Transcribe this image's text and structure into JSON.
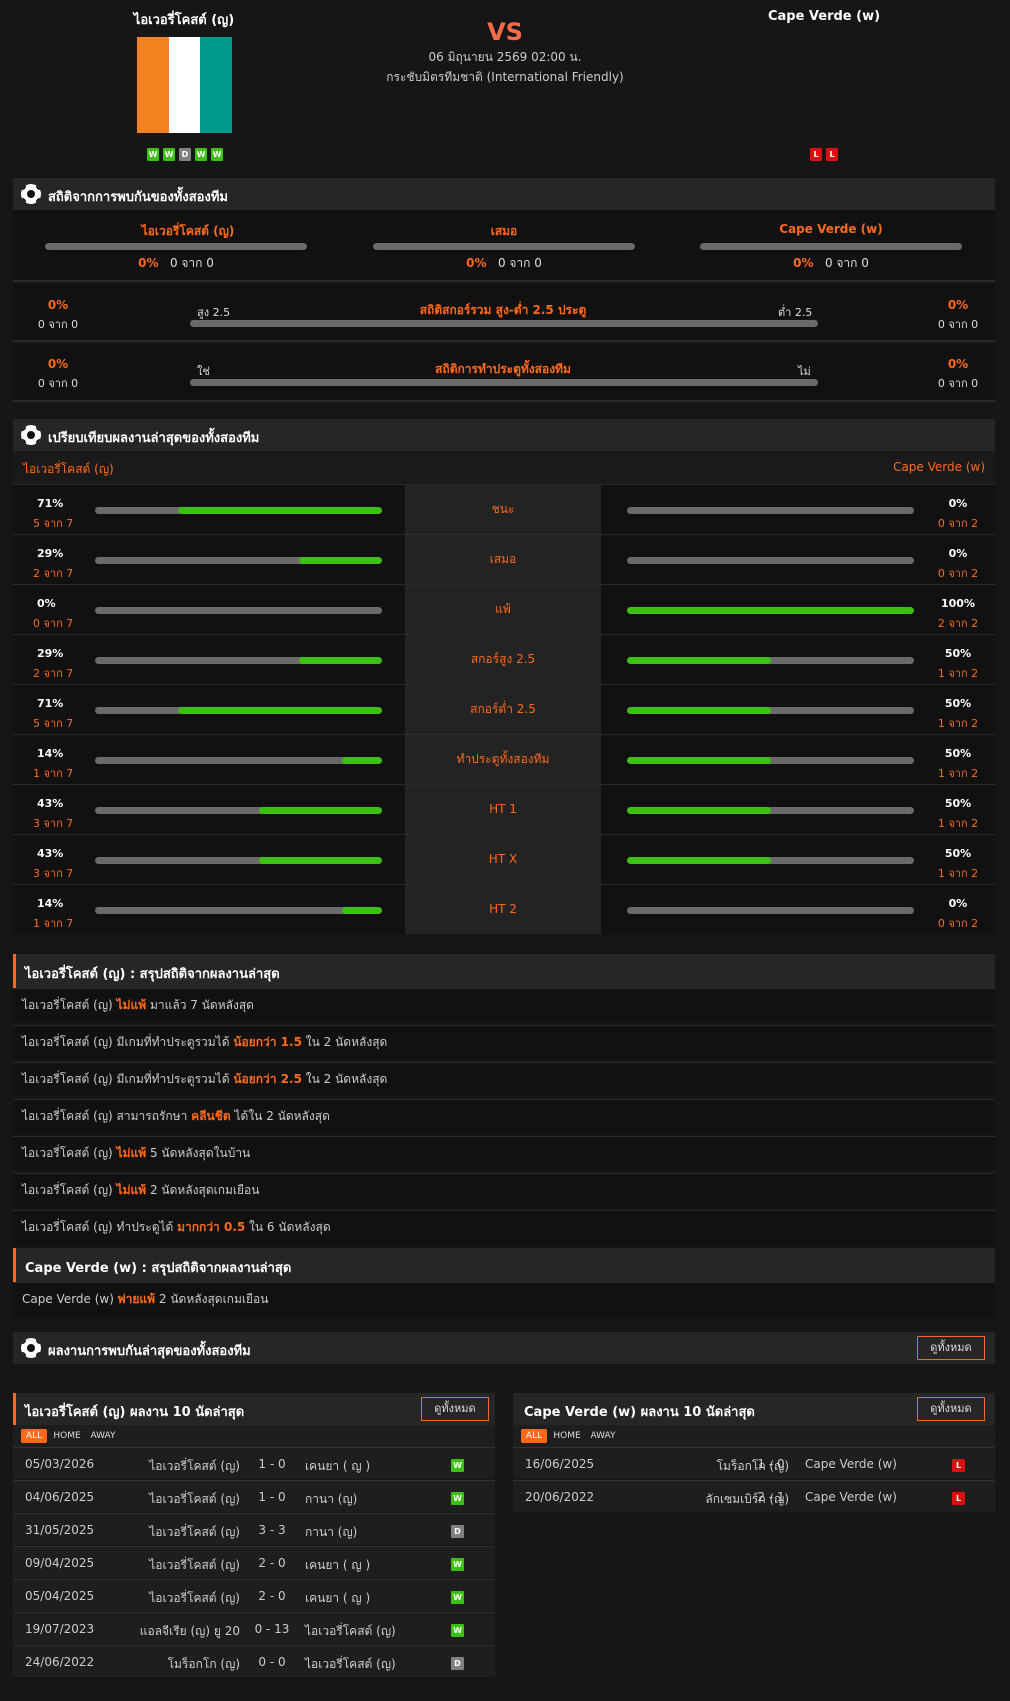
{
  "match": {
    "home": "ไอเวอรี่โคสต์ (ญ)",
    "away": "Cape Verde (w)",
    "vs": "VS",
    "datetime": "06 มิถุนายน 2569 02:00 น.",
    "competition": "กระชับมิตรทีมชาติ (International Friendly)",
    "home_form": [
      "W",
      "W",
      "D",
      "W",
      "W"
    ],
    "away_form": [
      "L",
      "L"
    ],
    "flag_colors": [
      "#f58220",
      "#ffffff",
      "#009a8c"
    ]
  },
  "h2h": {
    "title": "สถิติจากการพบกันของทั้งสองทีม",
    "home": "ไอเวอรี่โคสต์ (ญ)",
    "draw": "เสมอ",
    "away": "Cape Verde (w)",
    "home_pct": "0%",
    "home_of": "0 จาก 0",
    "draw_pct": "0%",
    "draw_of": "0 จาก 0",
    "away_pct": "0%",
    "away_of": "0 จาก 0"
  },
  "ou": {
    "title": "สถิติสกอร์รวม สูง-ต่ำ 2.5 ประตู",
    "left_label": "สูง 2.5",
    "right_label": "ต่ำ 2.5",
    "left_pct": "0%",
    "left_of": "0 จาก 0",
    "right_pct": "0%",
    "right_of": "0 จาก 0"
  },
  "btts": {
    "title": "สถิติการทำประตูทั้งสองทีม",
    "left_label": "ใช่",
    "right_label": "ไม่",
    "left_pct": "0%",
    "left_of": "0 จาก 0",
    "right_pct": "0%",
    "right_of": "0 จาก 0"
  },
  "compare": {
    "title": "เปรียบเทียบผลงานล่าสุดของทั้งสองทีม",
    "home": "ไอเวอรี่โคสต์ (ญ)",
    "away": "Cape Verde (w)",
    "rows": [
      {
        "label": "ชนะ",
        "hp": "71%",
        "hc": "5 จาก 7",
        "hv": 0.71,
        "ap": "0%",
        "ac": "0 จาก 2",
        "av": 0
      },
      {
        "label": "เสมอ",
        "hp": "29%",
        "hc": "2 จาก 7",
        "hv": 0.29,
        "ap": "0%",
        "ac": "0 จาก 2",
        "av": 0
      },
      {
        "label": "แพ้",
        "hp": "0%",
        "hc": "0 จาก 7",
        "hv": 0,
        "ap": "100%",
        "ac": "2 จาก 2",
        "av": 1
      },
      {
        "label": "สกอร์สูง 2.5",
        "hp": "29%",
        "hc": "2 จาก 7",
        "hv": 0.29,
        "ap": "50%",
        "ac": "1 จาก 2",
        "av": 0.5
      },
      {
        "label": "สกอร์ต่ำ 2.5",
        "hp": "71%",
        "hc": "5 จาก 7",
        "hv": 0.71,
        "ap": "50%",
        "ac": "1 จาก 2",
        "av": 0.5
      },
      {
        "label": "ทำประตูทั้งสองทีม",
        "hp": "14%",
        "hc": "1 จาก 7",
        "hv": 0.14,
        "ap": "50%",
        "ac": "1 จาก 2",
        "av": 0.5
      },
      {
        "label": "HT 1",
        "hp": "43%",
        "hc": "3 จาก 7",
        "hv": 0.43,
        "ap": "50%",
        "ac": "1 จาก 2",
        "av": 0.5
      },
      {
        "label": "HT X",
        "hp": "43%",
        "hc": "3 จาก 7",
        "hv": 0.43,
        "ap": "50%",
        "ac": "1 จาก 2",
        "av": 0.5
      },
      {
        "label": "HT 2",
        "hp": "14%",
        "hc": "1 จาก 7",
        "hv": 0.14,
        "ap": "0%",
        "ac": "0 จาก 2",
        "av": 0
      }
    ]
  },
  "home_summary": {
    "title": "ไอเวอรี่โคสต์ (ญ) : สรุปสถิติจากผลงานล่าสุด",
    "lines": [
      [
        "ไอเวอรี่โคสต์ (ญ) ",
        "ไม่แพ้",
        " มาแล้ว 7 นัดหลังสุด"
      ],
      [
        "ไอเวอรี่โคสต์ (ญ) มีเกมที่ทำประตูรวมได้ ",
        "น้อยกว่า  1.5",
        " ใน 2 นัดหลังสุด"
      ],
      [
        "ไอเวอรี่โคสต์ (ญ) มีเกมที่ทำประตูรวมได้ ",
        "น้อยกว่า  2.5",
        " ใน 2 นัดหลังสุด"
      ],
      [
        "ไอเวอรี่โคสต์ (ญ) สามารถรักษา ",
        "คลีนชีต",
        " ได้ใน 2 นัดหลังสุด"
      ],
      [
        "ไอเวอรี่โคสต์ (ญ) ",
        "ไม่แพ้",
        " 5  นัดหลังสุดในบ้าน"
      ],
      [
        "ไอเวอรี่โคสต์ (ญ) ",
        "ไม่แพ้",
        " 2  นัดหลังสุดเกมเยือน"
      ],
      [
        "ไอเวอรี่โคสต์ (ญ) ทำประตูได้ ",
        "มากกว่า  0.5",
        " ใน 6 นัดหลังสุด"
      ]
    ]
  },
  "away_summary": {
    "title": "Cape Verde (w) : สรุปสถิติจากผลงานล่าสุด",
    "lines": [
      [
        "Cape Verde (w) ",
        "พ่ายแพ้",
        " 2  นัดหลังสุดเกมเยือน"
      ]
    ]
  },
  "h2h_results": {
    "title": "ผลงานการพบกันล่าสุดของทั้งสองทีม",
    "view_all": "ดูทั้งหมด"
  },
  "home_last": {
    "title": "ไอเวอรี่โคสต์ (ญ) ผลงาน 10 นัดล่าสุด",
    "view_all": "ดูทั้งหมด",
    "tabs": [
      "ALL",
      "HOME",
      "AWAY"
    ],
    "matches": [
      {
        "date": "05/03/2026",
        "home": "ไอเวอรี่โคสต์ (ญ)",
        "score": "1 - 0",
        "away": "เคนยา ( ญ )",
        "res": "W"
      },
      {
        "date": "04/06/2025",
        "home": "ไอเวอรี่โคสต์ (ญ)",
        "score": "1 - 0",
        "away": "กานา (ญ)",
        "res": "W"
      },
      {
        "date": "31/05/2025",
        "home": "ไอเวอรี่โคสต์ (ญ)",
        "score": "3 - 3",
        "away": "กานา (ญ)",
        "res": "D"
      },
      {
        "date": "09/04/2025",
        "home": "ไอเวอรี่โคสต์ (ญ)",
        "score": "2 - 0",
        "away": "เคนยา ( ญ )",
        "res": "W"
      },
      {
        "date": "05/04/2025",
        "home": "ไอเวอรี่โคสต์ (ญ)",
        "score": "2 - 0",
        "away": "เคนยา ( ญ )",
        "res": "W"
      },
      {
        "date": "19/07/2023",
        "home": "แอลจีเรีย (ญ) ยู 20",
        "score": "0 - 13",
        "away": "ไอเวอรี่โคสต์ (ญ)",
        "res": "W"
      },
      {
        "date": "24/06/2022",
        "home": "โมร็อกโก (ญ)",
        "score": "0 - 0",
        "away": "ไอเวอรี่โคสต์ (ญ)",
        "res": "D"
      }
    ]
  },
  "away_last": {
    "title": "Cape Verde (w) ผลงาน 10 นัดล่าสุด",
    "view_all": "ดูทั้งหมด",
    "tabs": [
      "ALL",
      "HOME",
      "AWAY"
    ],
    "matches": [
      {
        "date": "16/06/2025",
        "home": "โมร็อกโก (ญ)",
        "score": "1 - 0",
        "away": "Cape Verde (w)",
        "res": "L"
      },
      {
        "date": "20/06/2022",
        "home": "ลักเซมเบิร์ก (ญ)",
        "score": "2 - 1",
        "away": "Cape Verde (w)",
        "res": "L"
      }
    ]
  }
}
